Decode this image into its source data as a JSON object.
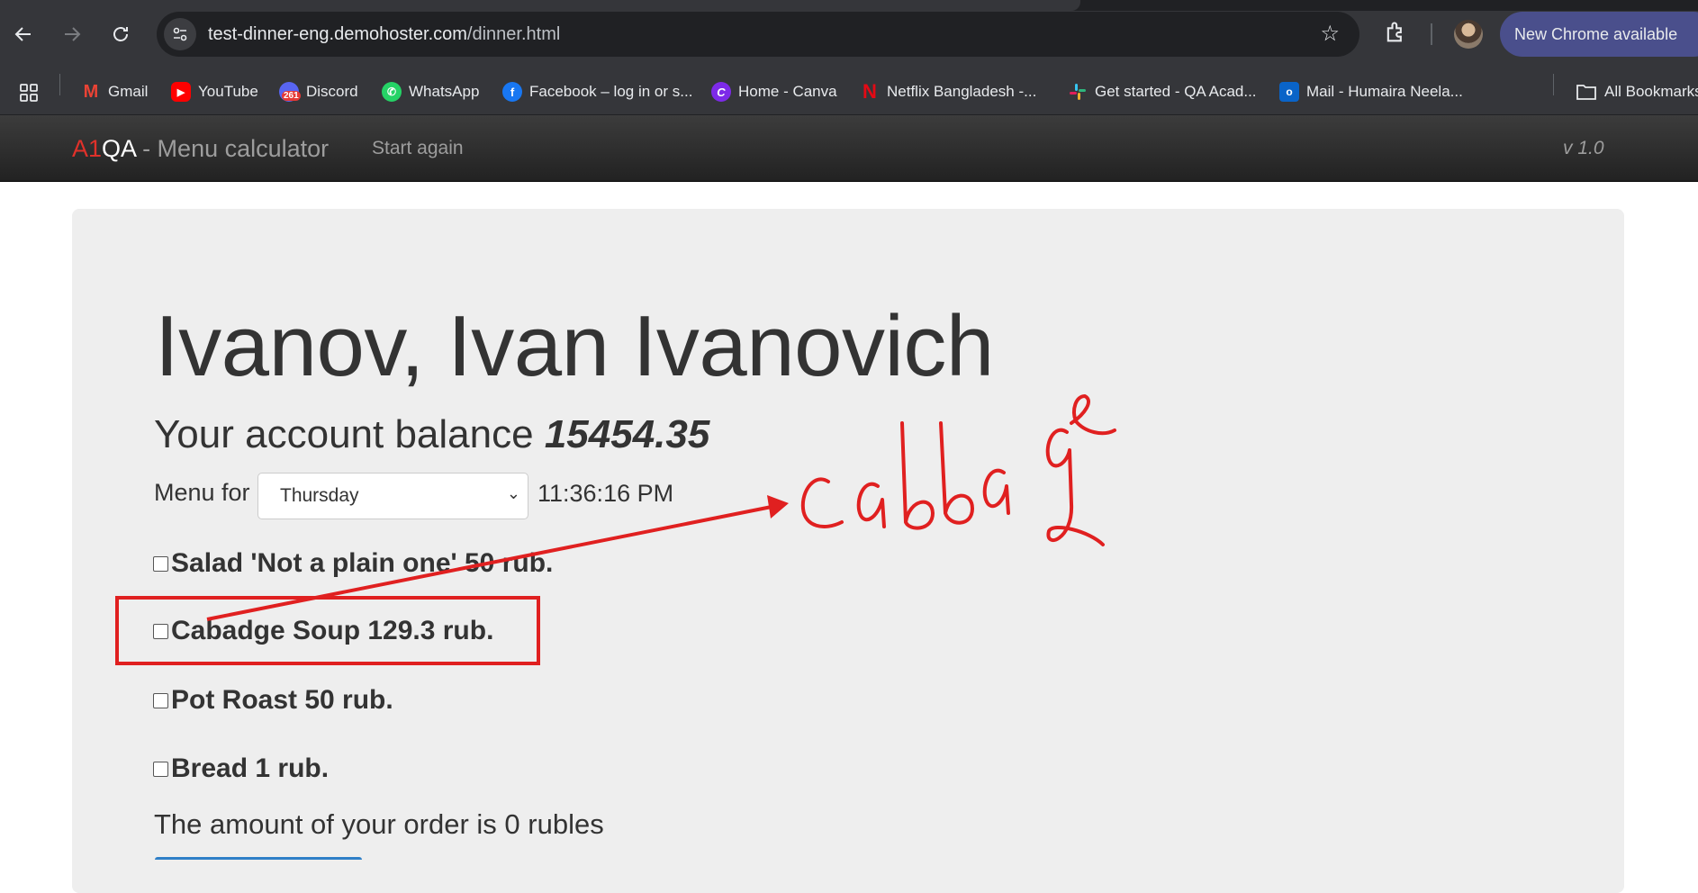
{
  "browser": {
    "url_host": "test-dinner-eng.demohoster.com",
    "url_path": "/dinner.html",
    "update_label": "New Chrome available",
    "bookmarks": [
      {
        "label": "Gmail",
        "icon": "gmail-icon",
        "color": "#ea4335"
      },
      {
        "label": "YouTube",
        "icon": "youtube-icon",
        "color": "#ff0000"
      },
      {
        "label": "Discord",
        "icon": "discord-icon",
        "color": "#5865f2",
        "badge": "261"
      },
      {
        "label": "WhatsApp",
        "icon": "whatsapp-icon",
        "color": "#25d366"
      },
      {
        "label": "Facebook – log in or s...",
        "icon": "facebook-icon",
        "color": "#1877f2"
      },
      {
        "label": "Home - Canva",
        "icon": "canva-icon",
        "color": "#7d2ae8"
      },
      {
        "label": "Netflix Bangladesh -...",
        "icon": "netflix-icon",
        "color": "#e50914"
      },
      {
        "label": "Get started - QA Acad...",
        "icon": "slack-icon",
        "color": "#e01e5a"
      },
      {
        "label": "Mail - Humaira Neela...",
        "icon": "outlook-icon",
        "color": "#0a64c8"
      }
    ],
    "all_bookmarks_label": "All Bookmarks"
  },
  "app": {
    "brand_a1": "A1",
    "brand_qa": "QA",
    "brand_rest": " - Menu calculator",
    "start_again": "Start again",
    "version": "v 1.0"
  },
  "main": {
    "user_name": "Ivanov, Ivan Ivanovich",
    "balance_label": "Your account balance ",
    "balance_value": "15454.35",
    "menu_for_label": "Menu for",
    "selected_day": "Thursday",
    "clock": "11:36:16 PM",
    "dishes": [
      {
        "label": "Salad 'Not a plain one' 50 rub.",
        "checked": false
      },
      {
        "label": "Cabadge Soup 129.3 rub.",
        "checked": false
      },
      {
        "label": "Pot Roast 50 rub.",
        "checked": false
      },
      {
        "label": "Bread 1 rub.",
        "checked": false
      }
    ],
    "order_total": "The amount of your order is 0 rubles"
  },
  "annotation": {
    "handwritten_text": "cabbage",
    "color": "#e02020"
  }
}
